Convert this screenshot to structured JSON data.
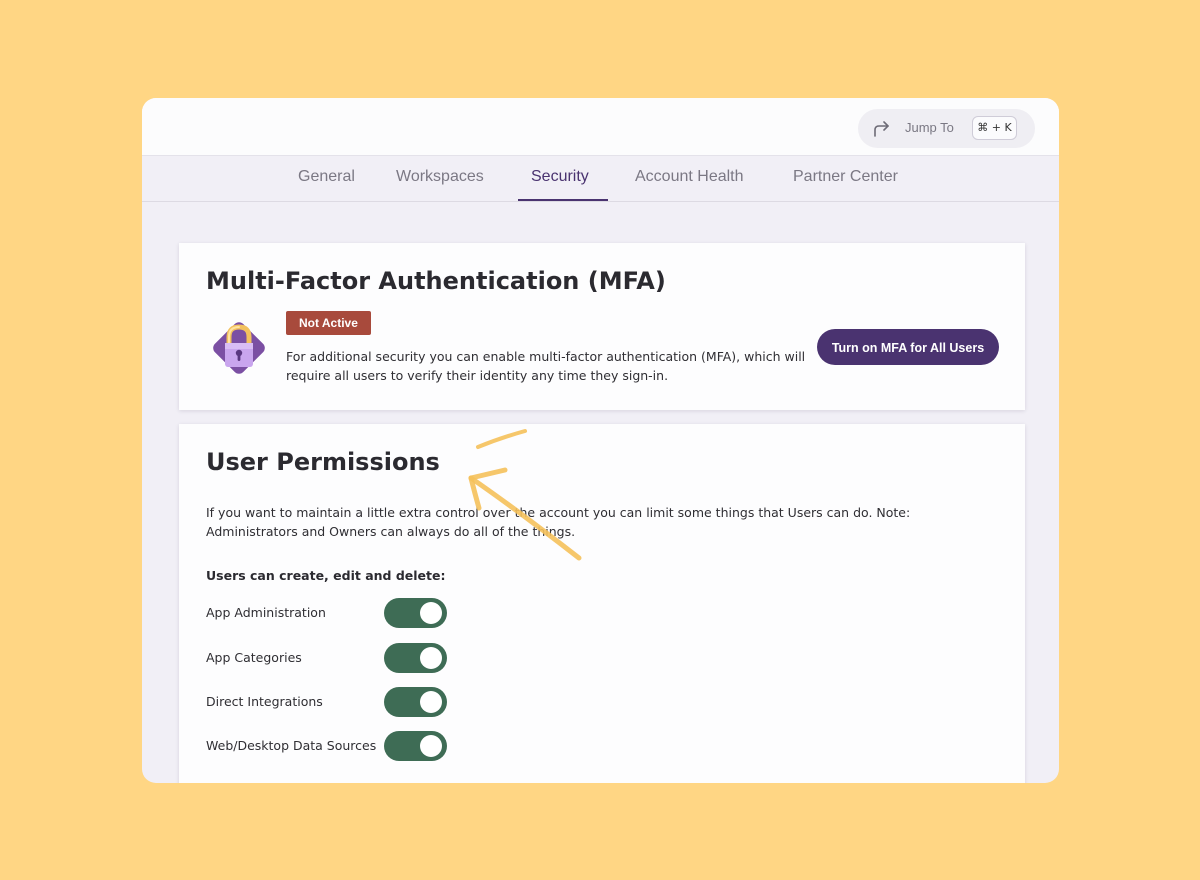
{
  "colors": {
    "background": "#FFD684",
    "accent": "#4A3370",
    "badge": "#A84A3C",
    "toggle_on": "#3E6C55",
    "annotation_arrow": "#F5C15B"
  },
  "topbar": {
    "jump_icon": "share-forward-icon",
    "jump_label": "Jump To",
    "shortcut": "⌘ + K"
  },
  "tabs": [
    {
      "label": "General",
      "active": false
    },
    {
      "label": "Workspaces",
      "active": false
    },
    {
      "label": "Security",
      "active": true
    },
    {
      "label": "Account Health",
      "active": false
    },
    {
      "label": "Partner Center",
      "active": false
    }
  ],
  "mfa": {
    "title": "Multi-Factor Authentication (MFA)",
    "icon": "padlock-icon",
    "status": "Not Active",
    "description": "For additional security you can enable multi-factor authentication (MFA), which will require all users to verify their identity any time they sign-in.",
    "button_label": "Turn on MFA for All Users"
  },
  "permissions": {
    "title": "User Permissions",
    "description": "If you want to maintain a little extra control over the account you can limit some things that Users can do. Note: Administrators and Owners can always do all of the things.",
    "subheading": "Users can create, edit and delete:",
    "items": [
      {
        "label": "App Administration",
        "enabled": true
      },
      {
        "label": "App Categories",
        "enabled": true
      },
      {
        "label": "Direct Integrations",
        "enabled": true
      },
      {
        "label": "Web/Desktop Data Sources",
        "enabled": true
      }
    ]
  }
}
